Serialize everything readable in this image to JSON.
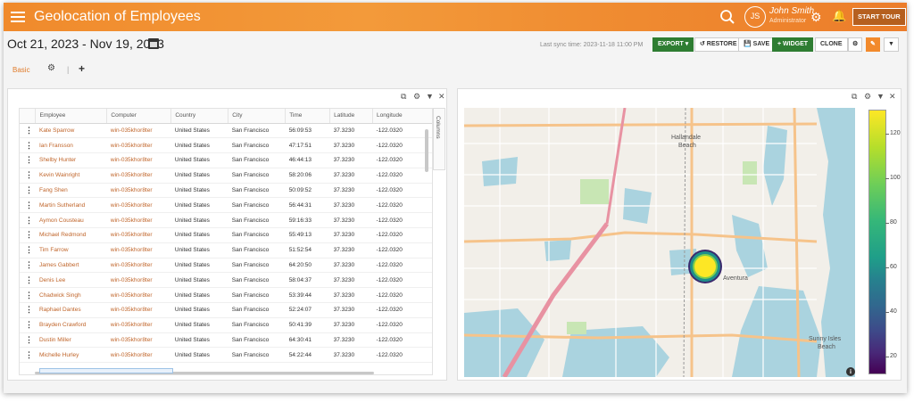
{
  "header": {
    "title": "Geolocation of Employees",
    "user_initials": "JS",
    "user_name": "John Smith",
    "user_role": "Administrator",
    "start_tour": "START TOUR"
  },
  "toolbar": {
    "date_range": "Oct 21, 2023 - Nov 19, 2023",
    "last_sync": "Last sync time: 2023-11-18 11:00 PM",
    "export": "EXPORT ▾",
    "restore": "↺ RESTORE",
    "save": "💾 SAVE",
    "widget": "+ WIDGET",
    "clone": "CLONE"
  },
  "tabs": {
    "basic": "Basic"
  },
  "table": {
    "columns_label": "Columns",
    "headers": [
      "Employee",
      "Computer",
      "Country",
      "City",
      "Time",
      "Latitude",
      "Longitude"
    ],
    "rows": [
      [
        "Kate Sparrow",
        "win-035khor8ter",
        "United States",
        "San Francisco",
        "56:09:53",
        "37.3230",
        "-122.0320"
      ],
      [
        "Ian Fransson",
        "win-035khor8ter",
        "United States",
        "San Francisco",
        "47:17:51",
        "37.3230",
        "-122.0320"
      ],
      [
        "Shelby Hunter",
        "win-035khor8ter",
        "United States",
        "San Francisco",
        "46:44:13",
        "37.3230",
        "-122.0320"
      ],
      [
        "Kevin Wainright",
        "win-035khor8ter",
        "United States",
        "San Francisco",
        "58:20:06",
        "37.3230",
        "-122.0320"
      ],
      [
        "Fang Shen",
        "win-035khor8ter",
        "United States",
        "San Francisco",
        "50:09:52",
        "37.3230",
        "-122.0320"
      ],
      [
        "Martin Sutherland",
        "win-035khor8ter",
        "United States",
        "San Francisco",
        "56:44:31",
        "37.3230",
        "-122.0320"
      ],
      [
        "Aymon Cousteau",
        "win-035khor8ter",
        "United States",
        "San Francisco",
        "59:16:33",
        "37.3230",
        "-122.0320"
      ],
      [
        "Michael Redmond",
        "win-035khor8ter",
        "United States",
        "San Francisco",
        "55:49:13",
        "37.3230",
        "-122.0320"
      ],
      [
        "Tim Farrow",
        "win-035khor8ter",
        "United States",
        "San Francisco",
        "51:52:54",
        "37.3230",
        "-122.0320"
      ],
      [
        "James Gabbert",
        "win-035khor8ter",
        "United States",
        "San Francisco",
        "64:20:50",
        "37.3230",
        "-122.0320"
      ],
      [
        "Denis Lee",
        "win-035khor8ter",
        "United States",
        "San Francisco",
        "58:04:37",
        "37.3230",
        "-122.0320"
      ],
      [
        "Chadwick Singh",
        "win-035khor8ter",
        "United States",
        "San Francisco",
        "53:39:44",
        "37.3230",
        "-122.0320"
      ],
      [
        "Raphael Dantes",
        "win-035khor8ter",
        "United States",
        "San Francisco",
        "52:24:07",
        "37.3230",
        "-122.0320"
      ],
      [
        "Brayden Crawford",
        "win-035khor8ter",
        "United States",
        "San Francisco",
        "50:41:39",
        "37.3230",
        "-122.0320"
      ],
      [
        "Dustin Miller",
        "win-035khor8ter",
        "United States",
        "San Francisco",
        "64:30:41",
        "37.3230",
        "-122.0320"
      ],
      [
        "Michelle Hurley",
        "win-035khor8ter",
        "United States",
        "San Francisco",
        "54:22:44",
        "37.3230",
        "-122.0320"
      ]
    ]
  },
  "map": {
    "labels": {
      "hallandale": "Hallandale",
      "beach": "Beach",
      "aventura": "Aventura",
      "sunny_isles": "Sunny Isles",
      "sunny_beach": "Beach"
    },
    "info": "i",
    "colorbar_ticks": [
      "120",
      "100",
      "80",
      "60",
      "40",
      "20"
    ],
    "colors": {
      "high": "#fde725",
      "low": "#440154",
      "water": "#aad3df",
      "land": "#f2efe9"
    }
  }
}
